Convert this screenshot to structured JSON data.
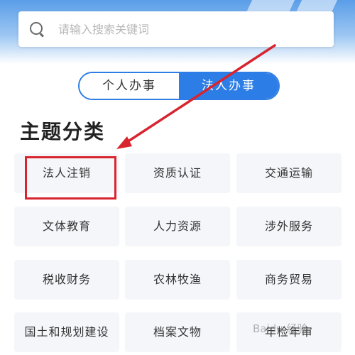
{
  "search": {
    "placeholder": "请输入搜索关键词"
  },
  "tabs": [
    {
      "label": "个人办事",
      "active": false
    },
    {
      "label": "法人办事",
      "active": true
    }
  ],
  "section_title": "主题分类",
  "categories": [
    "法人注销",
    "资质认证",
    "交通运输",
    "文体教育",
    "人力资源",
    "涉外服务",
    "税收财务",
    "农林牧渔",
    "商务贸易",
    "国土和规划建设",
    "档案文物",
    "年检年审"
  ],
  "watermark": "Baidu 经验",
  "colors": {
    "accent": "#2d7de6",
    "annotation": "#d8242f",
    "tile_bg": "#f4f6fa"
  }
}
